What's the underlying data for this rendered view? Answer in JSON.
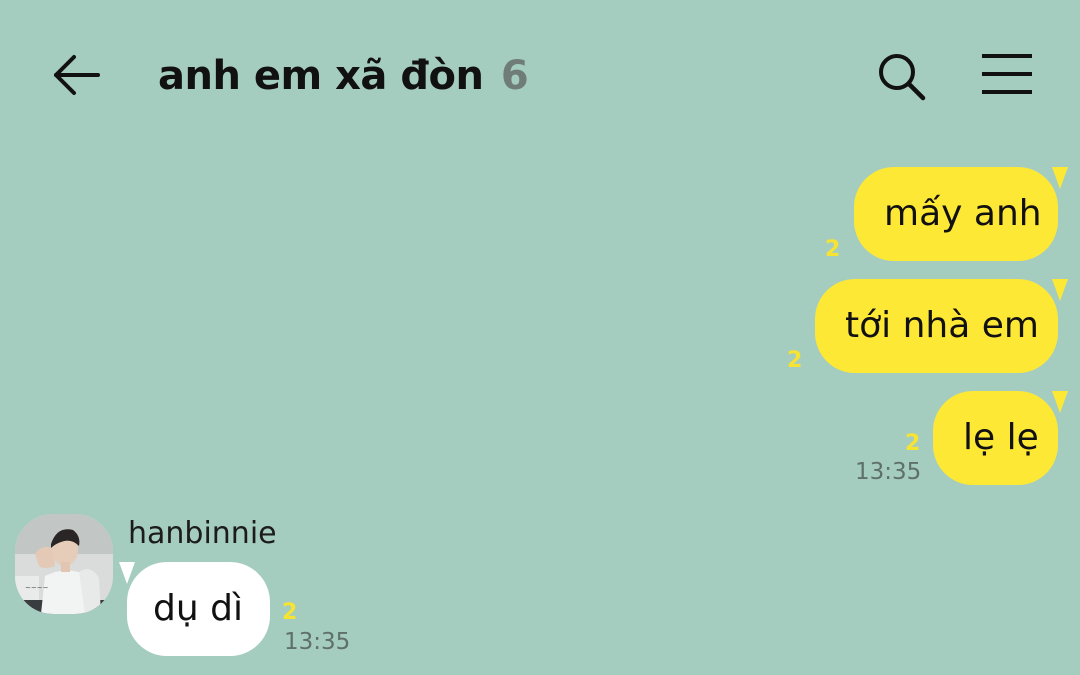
{
  "header": {
    "back_icon": "arrow-left-icon",
    "title": "anh em xã đòn",
    "member_count": "6",
    "search_icon": "search-icon",
    "menu_icon": "hamburger-menu-icon"
  },
  "colors": {
    "background": "#a5cdbf",
    "outgoing_bubble": "#fee836",
    "incoming_bubble": "#ffffff",
    "unread_count": "#f7e332",
    "timestamp": "#5f6f6a"
  },
  "messages": [
    {
      "direction": "outgoing",
      "text": "mấy anh",
      "unread": "2",
      "time": ""
    },
    {
      "direction": "outgoing",
      "text": "tới nhà em",
      "unread": "2",
      "time": ""
    },
    {
      "direction": "outgoing",
      "text": "lẹ lẹ",
      "unread": "2",
      "time": "13:35"
    },
    {
      "direction": "incoming",
      "sender": "hanbinnie",
      "text": "dụ dì",
      "unread": "2",
      "time": "13:35"
    }
  ]
}
